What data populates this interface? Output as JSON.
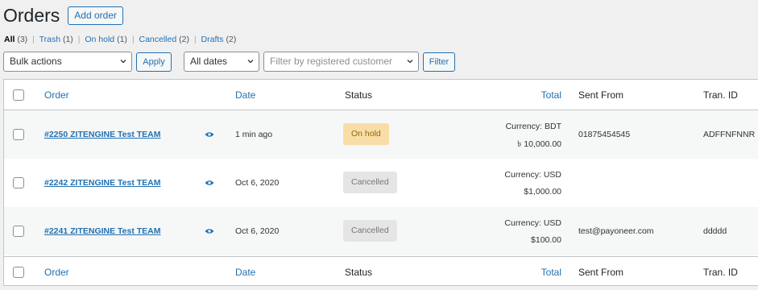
{
  "header": {
    "title": "Orders",
    "add_button": "Add order"
  },
  "views": [
    {
      "label": "All",
      "count": "(3)"
    },
    {
      "label": "Trash",
      "count": "(1)"
    },
    {
      "label": "On hold",
      "count": "(1)"
    },
    {
      "label": "Cancelled",
      "count": "(2)"
    },
    {
      "label": "Drafts",
      "count": "(2)"
    }
  ],
  "filters": {
    "bulk_actions": "Bulk actions",
    "apply": "Apply",
    "dates": "All dates",
    "customer_placeholder": "Filter by registered customer",
    "filter": "Filter"
  },
  "columns": {
    "order": "Order",
    "date": "Date",
    "status": "Status",
    "total": "Total",
    "sent_from": "Sent From",
    "tran_id": "Tran. ID"
  },
  "rows": [
    {
      "order": "#2250 ZITENGINE Test TEAM",
      "date": "1 min ago",
      "status": "On hold",
      "currency": "Currency: BDT",
      "amount": "৳ 10,000.00",
      "sent_from": "01875454545",
      "tran_id": "ADFFNFNNR"
    },
    {
      "order": "#2242 ZITENGINE Test TEAM",
      "date": "Oct 6, 2020",
      "status": "Cancelled",
      "currency": "Currency: USD",
      "amount": "$1,000.00",
      "sent_from": "",
      "tran_id": ""
    },
    {
      "order": "#2241 ZITENGINE Test TEAM",
      "date": "Oct 6, 2020",
      "status": "Cancelled",
      "currency": "Currency: USD",
      "amount": "$100.00",
      "sent_from": "test@payoneer.com",
      "tran_id": "ddddd"
    }
  ],
  "icons": {
    "preview": "eye-icon",
    "dropdown": "chevron-down-icon"
  },
  "colors": {
    "link": "#2271b1",
    "on_hold_bg": "#f8dda7",
    "cancelled_bg": "#e5e5e5"
  }
}
